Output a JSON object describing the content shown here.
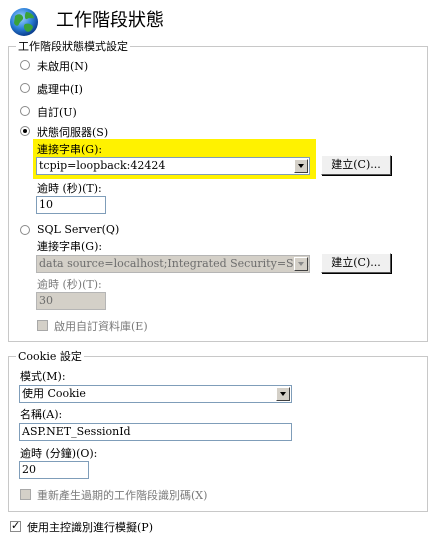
{
  "header": {
    "title": "工作階段狀態",
    "icon": "globe-icon"
  },
  "mode_group": {
    "legend": "工作階段狀態模式設定",
    "options": [
      {
        "label": "未啟用(N)",
        "selected": false
      },
      {
        "label": "處理中(I)",
        "selected": false
      },
      {
        "label": "自訂(U)",
        "selected": false
      },
      {
        "label": "狀態伺服器(S)",
        "selected": true
      },
      {
        "label": "SQL Server(Q)",
        "selected": false
      }
    ],
    "state_server": {
      "conn_label": "連接字串(G):",
      "conn_value": "tcpip=loopback:42424",
      "build_button": "建立(C)...",
      "timeout_label": "逾時 (秒)(T):",
      "timeout_value": "10"
    },
    "sql_server": {
      "conn_label": "連接字串(G):",
      "conn_value": "data source=localhost;Integrated Security=SSPI",
      "build_button": "建立(C)...",
      "timeout_label": "逾時 (秒)(T):",
      "timeout_value": "30",
      "custom_db_label": "啟用自訂資料庫(E)"
    }
  },
  "cookie_group": {
    "legend": "Cookie 設定",
    "mode_label": "模式(M):",
    "mode_value": "使用 Cookie",
    "name_label": "名稱(A):",
    "name_value": "ASP.NET_SessionId",
    "timeout_label": "逾時 (分鐘)(O):",
    "timeout_value": "20",
    "regen_label": "重新產生過期的工作階段識別碼(X)"
  },
  "impersonate": {
    "label": "使用主控識別進行模擬(P)",
    "checked": true
  },
  "colors": {
    "highlight": "#fff200",
    "input_border": "#7f9db9",
    "disabled_bg": "#d4d0c8"
  }
}
